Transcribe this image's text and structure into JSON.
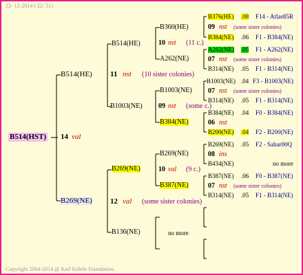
{
  "header": {
    "timestamp": "22- 12-2014 ( 22: 51)"
  },
  "footer": {
    "copyright": "Copyright 2004-2014 @ Karl Kehrle Foundation."
  },
  "root": {
    "id": "B514(HST)",
    "age": "14",
    "label": "val"
  },
  "gen1": {
    "top": {
      "id": "B514(HE)",
      "age": "11",
      "label": "nst",
      "note": "(10 sister colonies)"
    },
    "bottom": {
      "id": "B269(NE)",
      "age": "12",
      "label": "val",
      "note": "(some sister colonies)"
    }
  },
  "gen2": {
    "a": {
      "id": "B514(HE)",
      "age": "10",
      "label": "nst",
      "note": "(11 c.)"
    },
    "b": {
      "id": "B1003(NE)",
      "age": "09",
      "label": "nst",
      "note": "(some c.)"
    },
    "c": {
      "id": "B269(NE)",
      "age": "10",
      "label": "val",
      "note": "(9 c.)"
    },
    "d": {
      "id": "B136(NE)",
      "note": "no more"
    }
  },
  "gen3": {
    "a1": {
      "id": "B360(HE)"
    },
    "a2": {
      "id": "A262(NE)"
    },
    "b1": {
      "id": "B1003(NE)"
    },
    "b2": {
      "id": "B384(NE)"
    },
    "c1": {
      "id": "B269(NE)"
    },
    "c2": {
      "id": "B387(NE)"
    }
  },
  "gen4": [
    {
      "id": "B376(HE)",
      "val": ".08",
      "info": "F14 - Atlas85R"
    },
    {
      "age": "09",
      "label": "nst",
      "note": "(some sister colonies)"
    },
    {
      "id": "B384(NE)",
      "val": ".06",
      "info": "F1 - B384(NE)"
    },
    {
      "id": "A262(NE)",
      "val": ".05",
      "info": "F1 - A262(NE)"
    },
    {
      "age": "07",
      "label": "nst",
      "note": "(some sister colonies)"
    },
    {
      "id": "B314(NE)",
      "val": ".05",
      "info": "F1 - B314(NE)"
    },
    {
      "id": "B1003(NE)",
      "val": ".04",
      "info": "F3 - B1003(NE)"
    },
    {
      "age": "07",
      "label": "nst",
      "note": "(some sister colonies)"
    },
    {
      "id": "B314(NE)",
      "val": ".05",
      "info": "F1 - B314(NE)"
    },
    {
      "id": "B384(NE)",
      "val": ".04",
      "info": "F0 - B384(NE)"
    },
    {
      "age": "06",
      "label": "nst"
    },
    {
      "id": "B200(NE)",
      "val": ".04",
      "info": "F2 - B200(NE)"
    },
    {
      "id": "B269(NE)",
      "val": ".05",
      "info": "F2 - Sahar00Q"
    },
    {
      "age": "08",
      "label": "ins"
    },
    {
      "id": "B434(NE)",
      "info": "no more"
    },
    {
      "id": "B387(NE)",
      "val": ".06",
      "info": "F0 - B387(NE)"
    },
    {
      "age": "07",
      "label": "nst",
      "note": "(some sister colonies)"
    },
    {
      "id": "B314(NE)",
      "val": ".05",
      "info": "F1 - B314(NE)"
    }
  ]
}
